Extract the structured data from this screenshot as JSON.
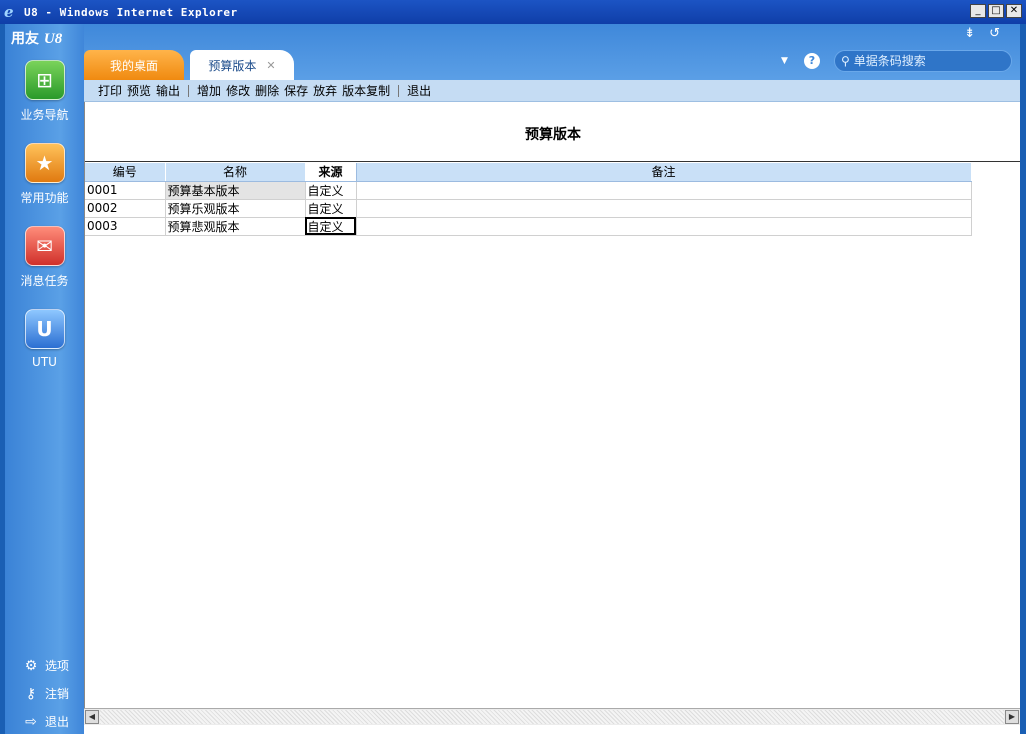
{
  "window": {
    "title": "U8 - Windows Internet Explorer",
    "ie_icon": "e",
    "buttons": {
      "minimize": "_",
      "maximize": "□",
      "close": "✕"
    }
  },
  "sidebar": {
    "brand": "用友",
    "brand_suffix": "U8",
    "items": [
      {
        "label": "业务导航",
        "icon": "business-navigation-icon",
        "glyph": "⊞"
      },
      {
        "label": "常用功能",
        "icon": "favorite-star-icon",
        "glyph": "★"
      },
      {
        "label": "消息任务",
        "icon": "message-envelope-icon",
        "glyph": "✉"
      },
      {
        "label": "UTU",
        "icon": "utu-icon",
        "glyph": "U"
      }
    ],
    "bottom": [
      {
        "label": "选项",
        "icon": "gear-icon",
        "glyph": "⚙"
      },
      {
        "label": "注销",
        "icon": "key-icon",
        "glyph": "⚷"
      },
      {
        "label": "退出",
        "icon": "exit-icon",
        "glyph": "⇨"
      }
    ]
  },
  "topbar": {
    "icons": {
      "collapse": "⇟",
      "refresh": "↺"
    },
    "tabs": [
      {
        "label": "我的桌面",
        "active": false
      },
      {
        "label": "预算版本",
        "active": true,
        "close": "✕"
      }
    ],
    "dropdown": "▼",
    "help": "?",
    "search": {
      "placeholder": "单据条码搜索",
      "icon": "⚲"
    }
  },
  "toolbar": {
    "group1": [
      "打印",
      "预览",
      "输出"
    ],
    "group2": [
      "增加",
      "修改",
      "删除",
      "保存",
      "放弃",
      "版本复制"
    ],
    "group3": [
      "退出"
    ]
  },
  "page": {
    "title": "预算版本"
  },
  "grid": {
    "columns": [
      "编号",
      "名称",
      "来源",
      "备注"
    ],
    "rows": [
      {
        "code": "0001",
        "name": "预算基本版本",
        "source": "自定义",
        "note": ""
      },
      {
        "code": "0002",
        "name": "预算乐观版本",
        "source": "自定义",
        "note": ""
      },
      {
        "code": "0003",
        "name": "预算悲观版本",
        "source": "自定义",
        "note": ""
      }
    ]
  },
  "scrollbar": {
    "left": "◀",
    "right": "▶"
  }
}
